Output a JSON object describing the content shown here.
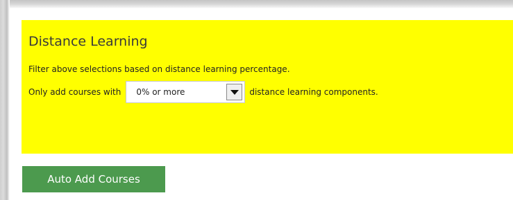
{
  "distance_learning": {
    "title": "Distance Learning",
    "description": "Filter above selections based on distance learning percentage.",
    "filter_prefix": "Only add courses with",
    "filter_suffix": "distance learning components.",
    "selected_value": "0% or more"
  },
  "actions": {
    "auto_add_label": "Auto Add Courses"
  },
  "colors": {
    "panel_background": "#ffff00",
    "button_background": "#4c9a4e"
  },
  "icons": {
    "dropdown": "chevron-down-icon"
  }
}
